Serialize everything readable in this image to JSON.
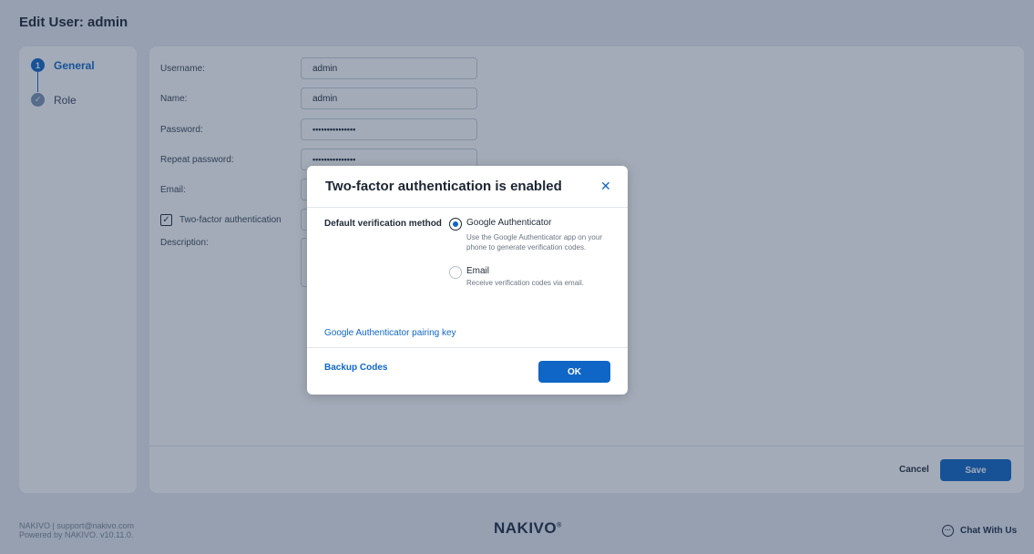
{
  "page": {
    "title": "Edit User: admin"
  },
  "steps": [
    {
      "number": "1",
      "label": "General",
      "state": "active"
    },
    {
      "label": "Role",
      "state": "done"
    }
  ],
  "form": {
    "username": {
      "label": "Username:",
      "value": "admin"
    },
    "name": {
      "label": "Name:",
      "value": "admin"
    },
    "password": {
      "label": "Password:",
      "value": "•••••••••••••••"
    },
    "repeat_password": {
      "label": "Repeat password:",
      "value": "•••••••••••••••"
    },
    "email": {
      "label": "Email:"
    },
    "two_factor": {
      "label": "Two-factor authentication",
      "checked": true
    },
    "description": {
      "label": "Description:"
    }
  },
  "actions": {
    "cancel_label": "Cancel",
    "save_label": "Save"
  },
  "footer": {
    "support": "NAKIVO | support@nakivo.com",
    "powered": "Powered by NAKIVO. v10.11.0.",
    "brand": "NAKIVO",
    "chat_label": "Chat With Us"
  },
  "modal": {
    "title": "Two-factor authentication is enabled",
    "close_icon": "close-icon",
    "method_label": "Default verification method",
    "options": [
      {
        "label": "Google Authenticator",
        "description": "Use the Google Authenticator app on your phone to generate verification codes.",
        "selected": true
      },
      {
        "label": "Email",
        "description": "Receive verification codes via email.",
        "selected": false
      }
    ],
    "pairing_link": "Google Authenticator pairing key",
    "backup_link": "Backup Codes",
    "ok_label": "OK"
  },
  "colors": {
    "accent": "#0f66c7",
    "overlay": "#233755"
  }
}
